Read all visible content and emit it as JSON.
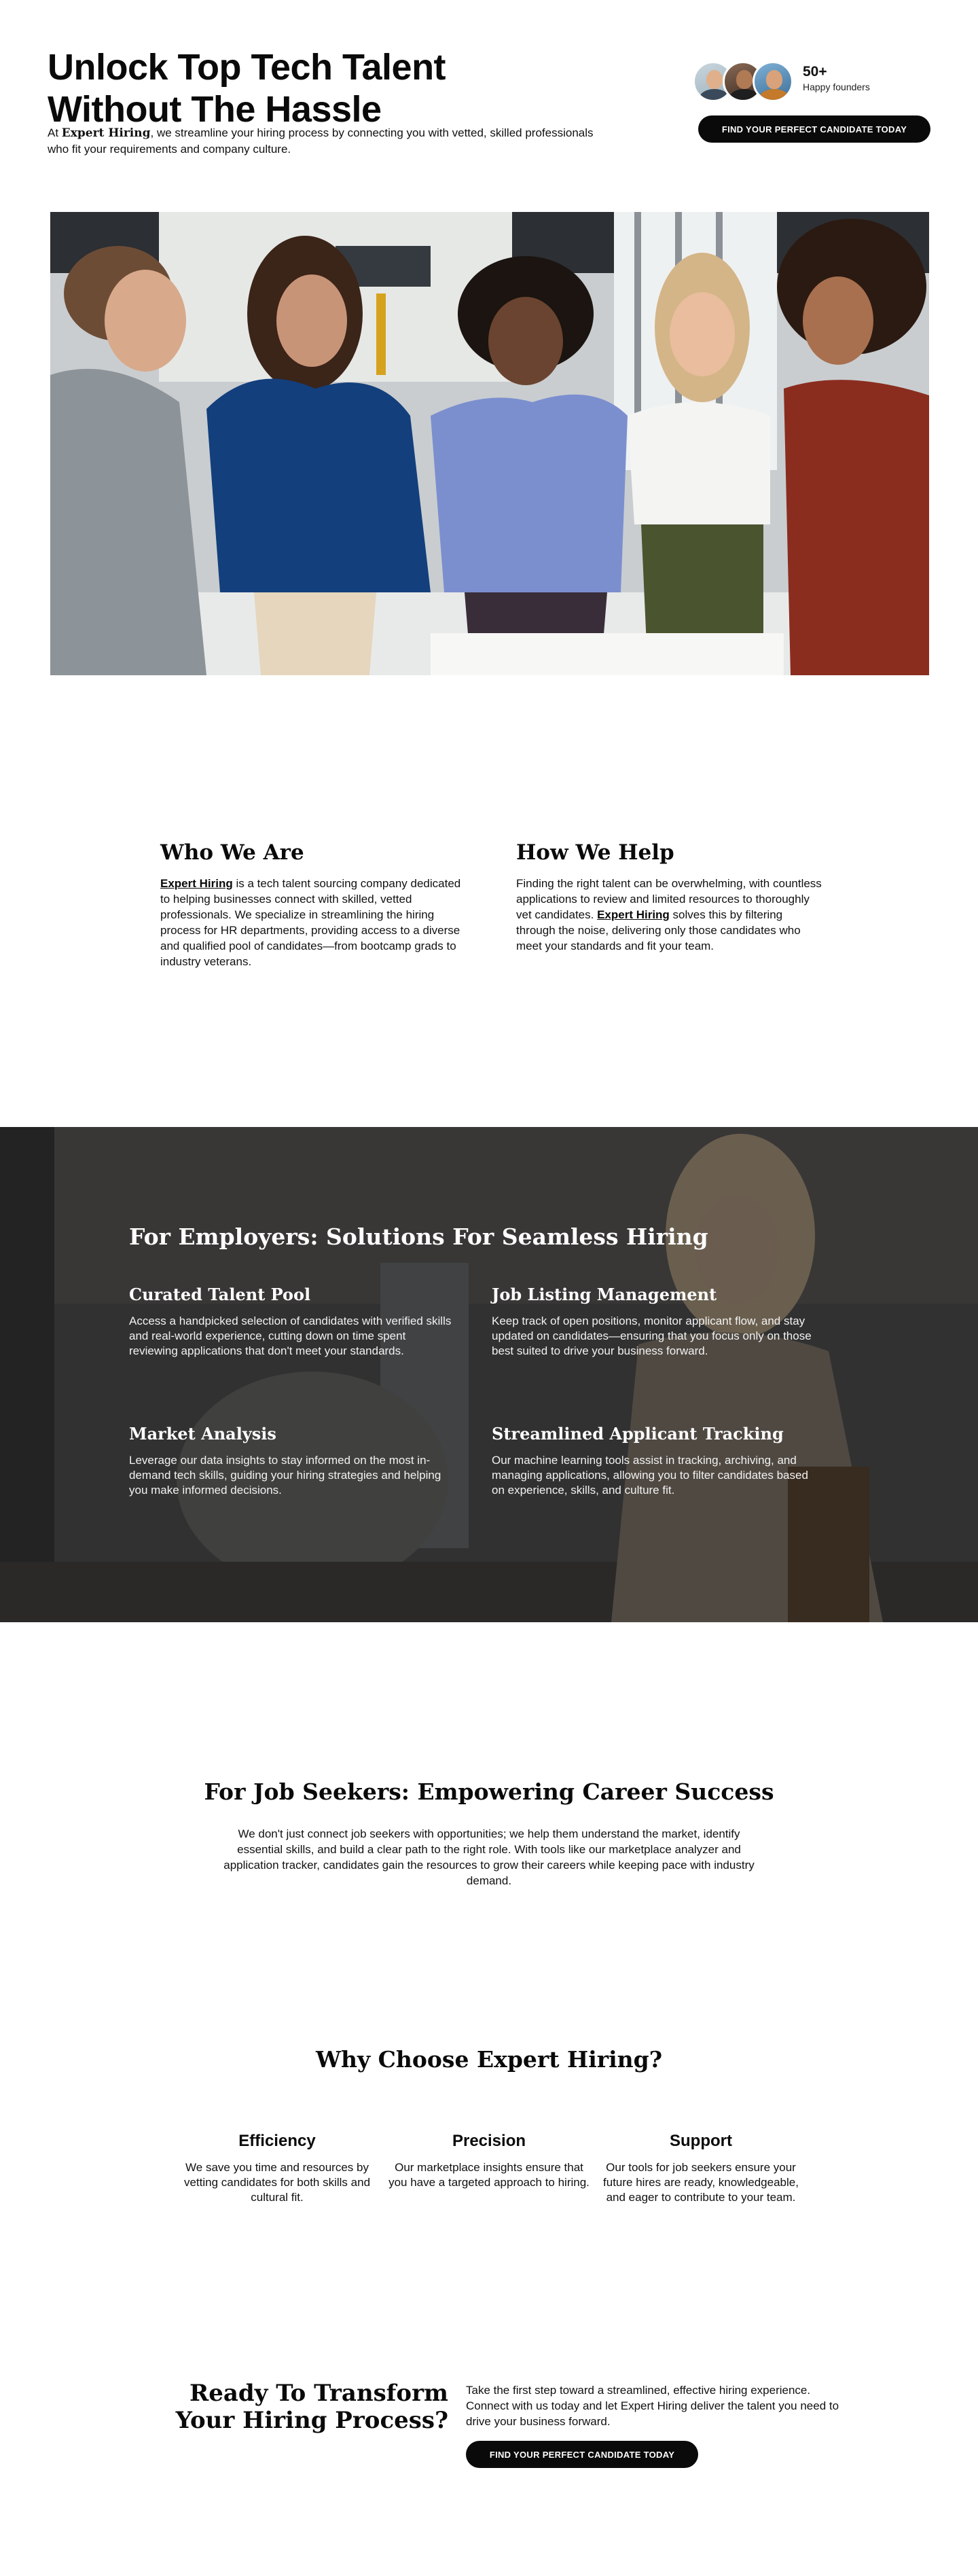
{
  "hero": {
    "title": "Unlock Top Tech Talent Without The Hassle",
    "desc_prefix": "At ",
    "desc_brand": "Expert Hiring",
    "desc_rest": ", we streamline your hiring process by connecting you with vetted, skilled professionals who fit your requirements and company culture.",
    "founders_count": "50+",
    "founders_label": "Happy founders",
    "cta_label": "FIND YOUR PERFECT CANDIDATE TODAY"
  },
  "who": {
    "title": "Who We Are",
    "brand": "Expert Hiring",
    "text": " is a tech talent sourcing company dedicated to helping businesses connect with skilled, vetted professionals. We specialize in streamlining the hiring process for HR departments, providing access to a diverse and qualified pool of candidates—from bootcamp grads to industry veterans."
  },
  "how": {
    "title": "How We Help",
    "text_before": "Finding the right talent can be overwhelming, with countless applications to review and limited resources to thoroughly vet candidates. ",
    "brand": "Expert Hiring",
    "text_after": " solves this by filtering through the noise, delivering only those candidates who meet your standards and fit your team."
  },
  "employers": {
    "title": "For Employers: Solutions For Seamless Hiring",
    "items": [
      {
        "title": "Curated Talent Pool",
        "text": "Access a handpicked selection of candidates with verified skills and real-world experience, cutting down on time spent reviewing applications that don't meet your standards."
      },
      {
        "title": "Job Listing Management",
        "text": "Keep track of open positions, monitor applicant flow, and stay updated on candidates—ensuring that you focus only on those best suited to drive your business forward."
      },
      {
        "title": "Market Analysis",
        "text": "Leverage our data insights to stay informed on the most in-demand tech skills, guiding your hiring strategies and helping you make informed decisions."
      },
      {
        "title": "Streamlined Applicant Tracking",
        "text": "Our machine learning tools assist in tracking, archiving, and managing applications, allowing you to filter candidates based on experience, skills, and culture fit."
      }
    ]
  },
  "seekers": {
    "title": "For Job Seekers: Empowering Career Success",
    "text": "We don't just connect job seekers with opportunities; we help them understand the market, identify essential skills, and build a clear path to the right role. With tools like our marketplace analyzer and application tracker, candidates gain the resources to grow their careers while keeping pace with industry demand."
  },
  "why": {
    "title": "Why Choose Expert Hiring?",
    "items": [
      {
        "title": "Efficiency",
        "text": "We save you time and resources by vetting candidates for both skills and cultural fit."
      },
      {
        "title": "Precision",
        "text": "Our marketplace insights ensure that you have a targeted approach to hiring."
      },
      {
        "title": "Support",
        "text": "Our tools for job seekers ensure your future hires are ready, knowledgeable, and eager to contribute to your team."
      }
    ]
  },
  "cta": {
    "title": "Ready To Transform Your Hiring Process?",
    "text": "Take the first step toward a streamlined, effective hiring experience. Connect with us today and let Expert Hiring deliver the talent you need to drive your business forward.",
    "button_label": "FIND YOUR PERFECT CANDIDATE TODAY"
  }
}
